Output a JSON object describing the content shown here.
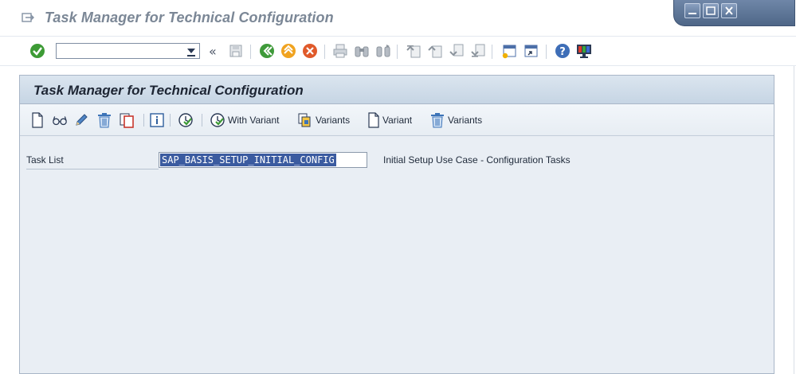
{
  "window": {
    "title": "Task Manager for Technical Configuration"
  },
  "toolbar": {
    "command_field_value": "",
    "collapse_glyph": "«",
    "icons": [
      "enter-icon",
      "save-icon",
      "back-icon",
      "exit-icon",
      "cancel-icon",
      "print-icon",
      "find-icon",
      "find-next-icon",
      "first-page-icon",
      "previous-page-icon",
      "next-page-icon",
      "last-page-icon",
      "create-session-icon",
      "shortcut-icon",
      "help-icon",
      "customize-layout-icon"
    ]
  },
  "panel": {
    "title": "Task Manager for Technical Configuration",
    "app_toolbar": {
      "with_variant_label": "With Variant",
      "variants_label_1": "Variants",
      "variant_label": "Variant",
      "variants_label_2": "Variants"
    },
    "task_list": {
      "label": "Task List",
      "value": "SAP_BASIS_SETUP_INITIAL_CONFIG",
      "description": "Initial Setup Use Case - Configuration Tasks"
    }
  },
  "colors": {
    "accent": "#3b5ba0",
    "panel_bg": "#e9eef4",
    "header_bg": "#c6d5e4",
    "title_grey": "#7b8796"
  }
}
